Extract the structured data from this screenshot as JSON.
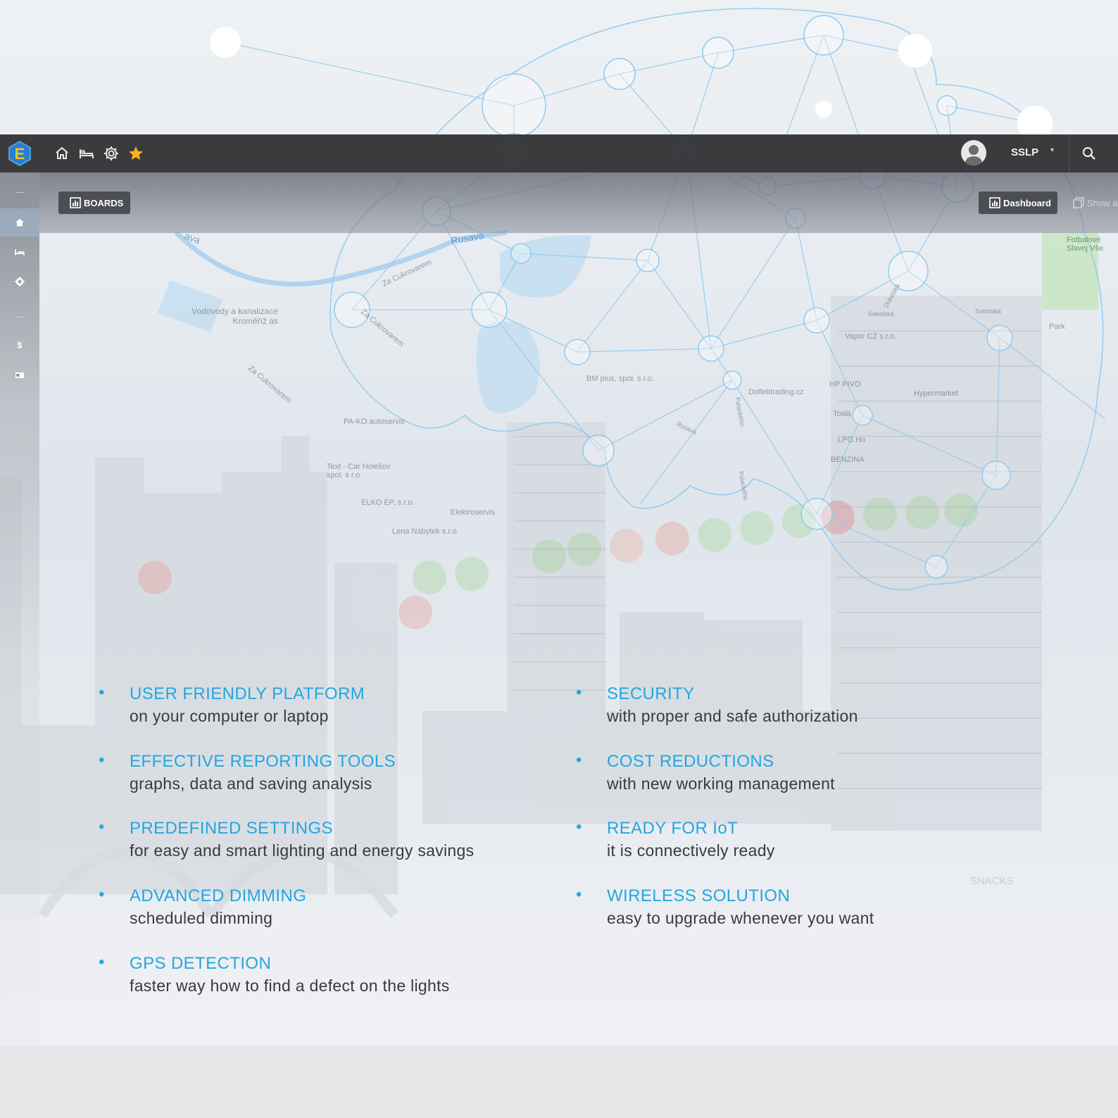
{
  "app": {
    "logo_letter": "E",
    "user_name": "SSLP"
  },
  "top_nav": [
    "home-icon",
    "bed-icon",
    "gear-icon",
    "star-icon"
  ],
  "toolbar": {
    "boards_label": "BOARDS",
    "dashboard_label": "Dashboard",
    "show_label": "Show a"
  },
  "map_labels": {
    "river": "Rusava",
    "river2": "ava",
    "street1": "Za Cukrovarem",
    "street2": "Za Cukrovarem",
    "street3": "Za Cukrovarem",
    "vodovody": "Vodovody a kanalizace Kroměříž as",
    "bm_plus": "BM plus, spol. s r.o.",
    "pako": "PA-KO autoservis",
    "dolfek": "Dolfektrading.cz",
    "hp_pivo": "HP PIVO",
    "sokolska": "Sokolská",
    "sokolska2": "Sokolská",
    "park": "Park",
    "fotbal": "Fotbalové Slavoj Vše",
    "vapor": "Vapor CZ s.r.o.",
    "elko": "ELKO EP, s.r.o.",
    "textcar": "Text - Car Holešov spol. s r.o",
    "elektro": "Elektroservis",
    "lena": "Lena Nábytek s.r.o",
    "hypermarket": "Hypermarket",
    "benzina": "BENZINA",
    "lpg": "LPG Ho",
    "tosla": "Tosla",
    "palackeho": "Palackého",
    "palackeho2": "Palackého",
    "rusava2": "Rusava",
    "dukelska": "Dukelská",
    "snacks": "SNACKS"
  },
  "features_left": [
    {
      "title": "USER FRIENDLY PLATFORM",
      "desc": "on your computer or laptop"
    },
    {
      "title": "EFFECTIVE REPORTING TOOLS",
      "desc": "graphs, data and saving analysis"
    },
    {
      "title": "PREDEFINED SETTINGS",
      "desc": "for easy and smart lighting and energy savings"
    },
    {
      "title": "ADVANCED DIMMING",
      "desc": "scheduled dimming"
    },
    {
      "title": "GPS DETECTION",
      "desc": "faster way how to find a defect on the lights"
    }
  ],
  "features_right": [
    {
      "title": "SECURITY",
      "desc": "with proper and safe authorization"
    },
    {
      "title": "COST REDUCTIONS",
      "desc": "with new working management"
    },
    {
      "title": "READY FOR IoT",
      "desc": "it is connectively ready"
    },
    {
      "title": "WIRELESS SOLUTION",
      "desc": "easy to upgrade whenever you want"
    }
  ],
  "colors": {
    "accent": "#24a6e0",
    "topbar": "#2d2d2f",
    "star": "#f4b41a",
    "desc_text": "#3a3a3a"
  }
}
